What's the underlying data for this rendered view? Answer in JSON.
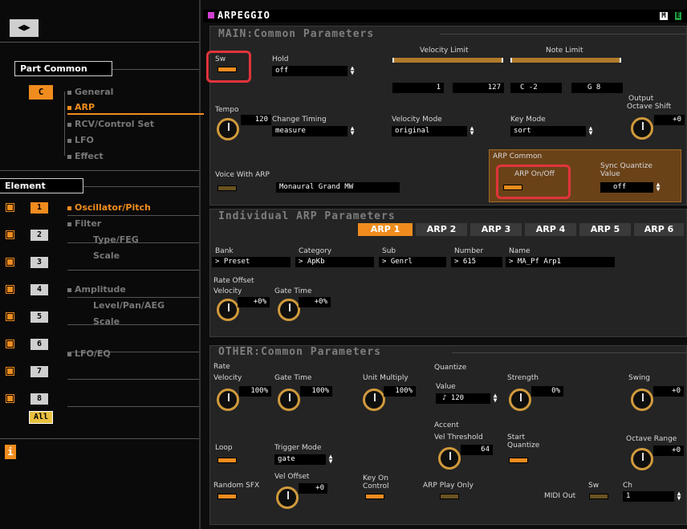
{
  "left": {
    "nav_arrow": "◀▶",
    "part_common": "Part Common",
    "part_badge": "C",
    "menu": [
      "General",
      "ARP",
      "RCV/Control Set",
      "LFO",
      "Effect"
    ],
    "element": "Element",
    "elements": [
      "1",
      "2",
      "3",
      "4",
      "5",
      "6",
      "7",
      "8"
    ],
    "elem_menu": [
      "Oscillator/Pitch",
      "Filter",
      "Type/FEG",
      "Scale",
      "Amplitude",
      "Level/Pan/AEG",
      "Scale",
      "LFO/EQ"
    ],
    "all": "All",
    "info": "i"
  },
  "title": "ARPEGGIO",
  "title_icons": {
    "m": "M",
    "e": "E"
  },
  "main": {
    "title": "MAIN:Common Parameters",
    "sw": "Sw",
    "hold": "Hold",
    "hold_val": "off",
    "velocity_limit": "Velocity Limit",
    "note_limit": "Note Limit",
    "vel_lo": "1",
    "vel_hi": "127",
    "note_lo": "C -2",
    "note_hi": "G 8",
    "tempo": "Tempo",
    "tempo_val": "120",
    "change_timing": "Change Timing",
    "change_timing_val": "measure",
    "velocity_mode": "Velocity Mode",
    "velocity_mode_val": "original",
    "key_mode": "Key Mode",
    "key_mode_val": "sort",
    "output_octave": "Output\nOctave Shift",
    "output_octave_l1": "Output",
    "output_octave_l2": "Octave Shift",
    "output_octave_val": "+0",
    "arp_common": "ARP Common",
    "arp_onoff": "ARP On/Off",
    "sync_quantize_l1": "Sync Quantize",
    "sync_quantize_l2": "Value",
    "sync_val": "off",
    "voice_with_arp": "Voice With ARP",
    "voice_val": "Monaural Grand MW"
  },
  "indiv": {
    "title": "Individual ARP Parameters",
    "tabs": [
      "ARP 1",
      "ARP 2",
      "ARP 3",
      "ARP 4",
      "ARP 5",
      "ARP 6"
    ],
    "bank": "Bank",
    "bank_val": "> Preset",
    "category": "Category",
    "category_val": "> ApKb",
    "sub": "Sub",
    "sub_val": "> Genrl",
    "number": "Number",
    "number_val": "> 615",
    "name": "Name",
    "name_val": "> MA_Pf Arp1",
    "rate_offset": "Rate Offset",
    "velocity": "Velocity",
    "velocity_val": "+0%",
    "gate_time": "Gate Time",
    "gate_time_val": "+0%"
  },
  "other": {
    "title": "OTHER:Common Parameters",
    "rate": "Rate",
    "velocity": "Velocity",
    "velocity_val": "100%",
    "gate_time": "Gate Time",
    "gate_time_val": "100%",
    "unit_multiply": "Unit Multiply",
    "unit_multiply_val": "100%",
    "quantize": "Quantize",
    "value": "Value",
    "value_val": "♪ 120",
    "strength": "Strength",
    "strength_val": "0%",
    "swing": "Swing",
    "swing_val": "+0",
    "accent": "Accent",
    "vel_threshold": "Vel Threshold",
    "vel_threshold_val": "64",
    "start_quantize_l1": "Start",
    "start_quantize_l2": "Quantize",
    "loop": "Loop",
    "trigger_mode": "Trigger Mode",
    "trigger_mode_val": "gate",
    "octave_range": "Octave Range",
    "octave_range_val": "+0",
    "random_sfx": "Random SFX",
    "vel_offset": "Vel Offset",
    "vel_offset_val": "+0",
    "key_on_l1": "Key On",
    "key_on_l2": "Control",
    "arp_play_only": "ARP Play Only",
    "midi_out": "MIDI Out",
    "midi_sw": "Sw",
    "ch": "Ch",
    "ch_val": "1"
  },
  "colors": {
    "accent": "#f08c1e",
    "highlight": "#e0343c",
    "knob": "#d09a3c"
  }
}
